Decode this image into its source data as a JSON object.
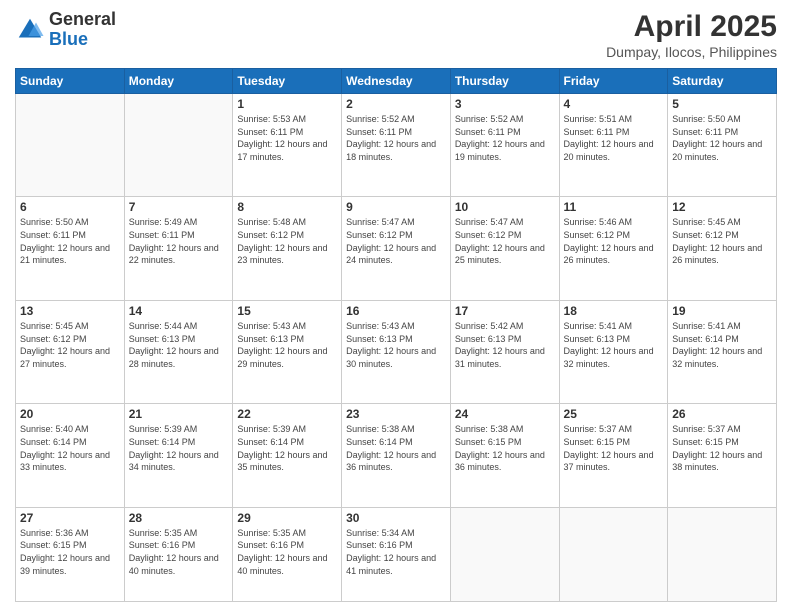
{
  "header": {
    "logo_general": "General",
    "logo_blue": "Blue",
    "title": "April 2025",
    "location": "Dumpay, Ilocos, Philippines"
  },
  "weekdays": [
    "Sunday",
    "Monday",
    "Tuesday",
    "Wednesday",
    "Thursday",
    "Friday",
    "Saturday"
  ],
  "weeks": [
    [
      {
        "day": "",
        "info": ""
      },
      {
        "day": "",
        "info": ""
      },
      {
        "day": "1",
        "info": "Sunrise: 5:53 AM\nSunset: 6:11 PM\nDaylight: 12 hours and 17 minutes."
      },
      {
        "day": "2",
        "info": "Sunrise: 5:52 AM\nSunset: 6:11 PM\nDaylight: 12 hours and 18 minutes."
      },
      {
        "day": "3",
        "info": "Sunrise: 5:52 AM\nSunset: 6:11 PM\nDaylight: 12 hours and 19 minutes."
      },
      {
        "day": "4",
        "info": "Sunrise: 5:51 AM\nSunset: 6:11 PM\nDaylight: 12 hours and 20 minutes."
      },
      {
        "day": "5",
        "info": "Sunrise: 5:50 AM\nSunset: 6:11 PM\nDaylight: 12 hours and 20 minutes."
      }
    ],
    [
      {
        "day": "6",
        "info": "Sunrise: 5:50 AM\nSunset: 6:11 PM\nDaylight: 12 hours and 21 minutes."
      },
      {
        "day": "7",
        "info": "Sunrise: 5:49 AM\nSunset: 6:11 PM\nDaylight: 12 hours and 22 minutes."
      },
      {
        "day": "8",
        "info": "Sunrise: 5:48 AM\nSunset: 6:12 PM\nDaylight: 12 hours and 23 minutes."
      },
      {
        "day": "9",
        "info": "Sunrise: 5:47 AM\nSunset: 6:12 PM\nDaylight: 12 hours and 24 minutes."
      },
      {
        "day": "10",
        "info": "Sunrise: 5:47 AM\nSunset: 6:12 PM\nDaylight: 12 hours and 25 minutes."
      },
      {
        "day": "11",
        "info": "Sunrise: 5:46 AM\nSunset: 6:12 PM\nDaylight: 12 hours and 26 minutes."
      },
      {
        "day": "12",
        "info": "Sunrise: 5:45 AM\nSunset: 6:12 PM\nDaylight: 12 hours and 26 minutes."
      }
    ],
    [
      {
        "day": "13",
        "info": "Sunrise: 5:45 AM\nSunset: 6:12 PM\nDaylight: 12 hours and 27 minutes."
      },
      {
        "day": "14",
        "info": "Sunrise: 5:44 AM\nSunset: 6:13 PM\nDaylight: 12 hours and 28 minutes."
      },
      {
        "day": "15",
        "info": "Sunrise: 5:43 AM\nSunset: 6:13 PM\nDaylight: 12 hours and 29 minutes."
      },
      {
        "day": "16",
        "info": "Sunrise: 5:43 AM\nSunset: 6:13 PM\nDaylight: 12 hours and 30 minutes."
      },
      {
        "day": "17",
        "info": "Sunrise: 5:42 AM\nSunset: 6:13 PM\nDaylight: 12 hours and 31 minutes."
      },
      {
        "day": "18",
        "info": "Sunrise: 5:41 AM\nSunset: 6:13 PM\nDaylight: 12 hours and 32 minutes."
      },
      {
        "day": "19",
        "info": "Sunrise: 5:41 AM\nSunset: 6:14 PM\nDaylight: 12 hours and 32 minutes."
      }
    ],
    [
      {
        "day": "20",
        "info": "Sunrise: 5:40 AM\nSunset: 6:14 PM\nDaylight: 12 hours and 33 minutes."
      },
      {
        "day": "21",
        "info": "Sunrise: 5:39 AM\nSunset: 6:14 PM\nDaylight: 12 hours and 34 minutes."
      },
      {
        "day": "22",
        "info": "Sunrise: 5:39 AM\nSunset: 6:14 PM\nDaylight: 12 hours and 35 minutes."
      },
      {
        "day": "23",
        "info": "Sunrise: 5:38 AM\nSunset: 6:14 PM\nDaylight: 12 hours and 36 minutes."
      },
      {
        "day": "24",
        "info": "Sunrise: 5:38 AM\nSunset: 6:15 PM\nDaylight: 12 hours and 36 minutes."
      },
      {
        "day": "25",
        "info": "Sunrise: 5:37 AM\nSunset: 6:15 PM\nDaylight: 12 hours and 37 minutes."
      },
      {
        "day": "26",
        "info": "Sunrise: 5:37 AM\nSunset: 6:15 PM\nDaylight: 12 hours and 38 minutes."
      }
    ],
    [
      {
        "day": "27",
        "info": "Sunrise: 5:36 AM\nSunset: 6:15 PM\nDaylight: 12 hours and 39 minutes."
      },
      {
        "day": "28",
        "info": "Sunrise: 5:35 AM\nSunset: 6:16 PM\nDaylight: 12 hours and 40 minutes."
      },
      {
        "day": "29",
        "info": "Sunrise: 5:35 AM\nSunset: 6:16 PM\nDaylight: 12 hours and 40 minutes."
      },
      {
        "day": "30",
        "info": "Sunrise: 5:34 AM\nSunset: 6:16 PM\nDaylight: 12 hours and 41 minutes."
      },
      {
        "day": "",
        "info": ""
      },
      {
        "day": "",
        "info": ""
      },
      {
        "day": "",
        "info": ""
      }
    ]
  ]
}
